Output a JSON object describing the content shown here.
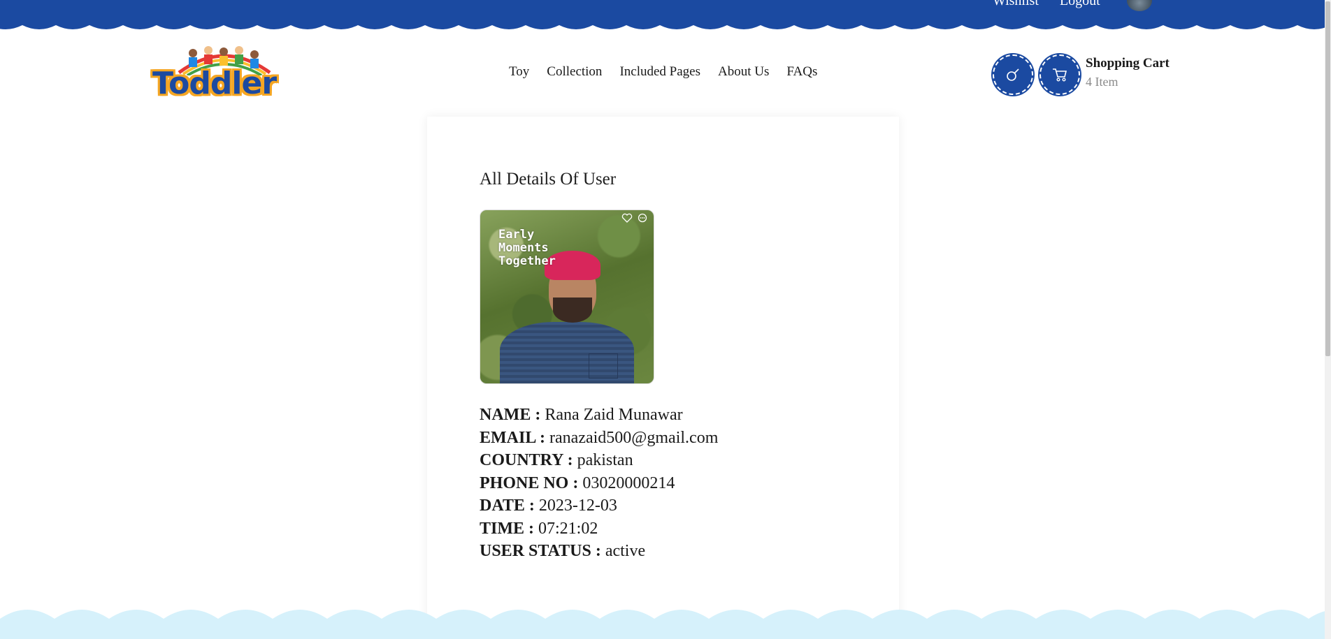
{
  "topbar": {
    "links": [
      "Wishlist",
      "Logout"
    ],
    "color": "#1b4aa1"
  },
  "logo": {
    "text": "Toddler"
  },
  "nav": {
    "items": [
      "Toy",
      "Collection",
      "Included Pages",
      "About Us",
      "FAQs"
    ]
  },
  "header": {
    "search_icon": "search-icon",
    "cart_icon": "cart-icon",
    "cart_title": "Shopping Cart",
    "cart_count": "4 Item"
  },
  "card": {
    "title": "All Details Of User",
    "photo_caption": "Early\nMoments\nTogether",
    "fields": [
      {
        "label": "NAME :",
        "value": "Rana Zaid Munawar"
      },
      {
        "label": "EMAIL :",
        "value": "ranazaid500@gmail.com"
      },
      {
        "label": "COUNTRY :",
        "value": "pakistan"
      },
      {
        "label": "PHONE NO :",
        "value": "03020000214"
      },
      {
        "label": "DATE :",
        "value": "2023-12-03"
      },
      {
        "label": "TIME :",
        "value": "07:21:02"
      },
      {
        "label": "USER STATUS :",
        "value": "active"
      }
    ]
  },
  "colors": {
    "brand_blue": "#1b4aa1",
    "logo_orange": "#f5a623",
    "cloud": "#d6f1fb"
  }
}
